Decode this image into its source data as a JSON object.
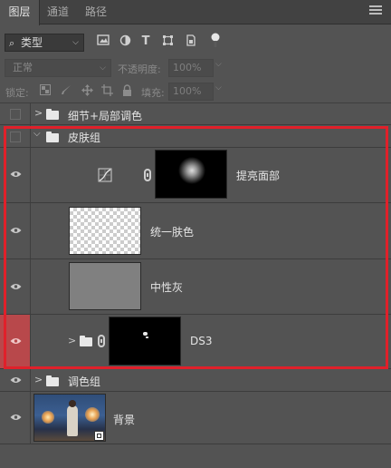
{
  "tabs": [
    {
      "label": "图层",
      "active": true
    },
    {
      "label": "通道",
      "active": false
    },
    {
      "label": "路径",
      "active": false
    }
  ],
  "filter": {
    "search_icon": "search-icon",
    "kind_label": "类型"
  },
  "blend": {
    "mode": "正常",
    "opacity_label": "不透明度:",
    "opacity_value": "100%"
  },
  "lock": {
    "label": "锁定:",
    "fill_label": "填充:",
    "fill_value": "100%"
  },
  "layers": [
    {
      "name": "细节+局部调色",
      "type": "group",
      "visible": false,
      "expanded": false
    },
    {
      "name": "皮肤组",
      "type": "group",
      "visible": false,
      "expanded": true
    },
    {
      "name": "提亮面部",
      "type": "curves-adjustment",
      "visible": true,
      "has_mask": true
    },
    {
      "name": "统一肤色",
      "type": "transparent-pixel-layer",
      "visible": true
    },
    {
      "name": "中性灰",
      "type": "gray-pixel-layer",
      "visible": true
    },
    {
      "name": "DS3",
      "type": "group",
      "visible": true,
      "expanded": false,
      "has_mask": true,
      "selected": true
    },
    {
      "name": "调色组",
      "type": "group",
      "visible": true,
      "expanded": false
    },
    {
      "name": "背景",
      "type": "smart-object",
      "visible": true
    }
  ],
  "colors": {
    "panel_bg": "#535353",
    "highlight_box": "#e0202a",
    "selected_eye_cell": "#b8484b"
  }
}
